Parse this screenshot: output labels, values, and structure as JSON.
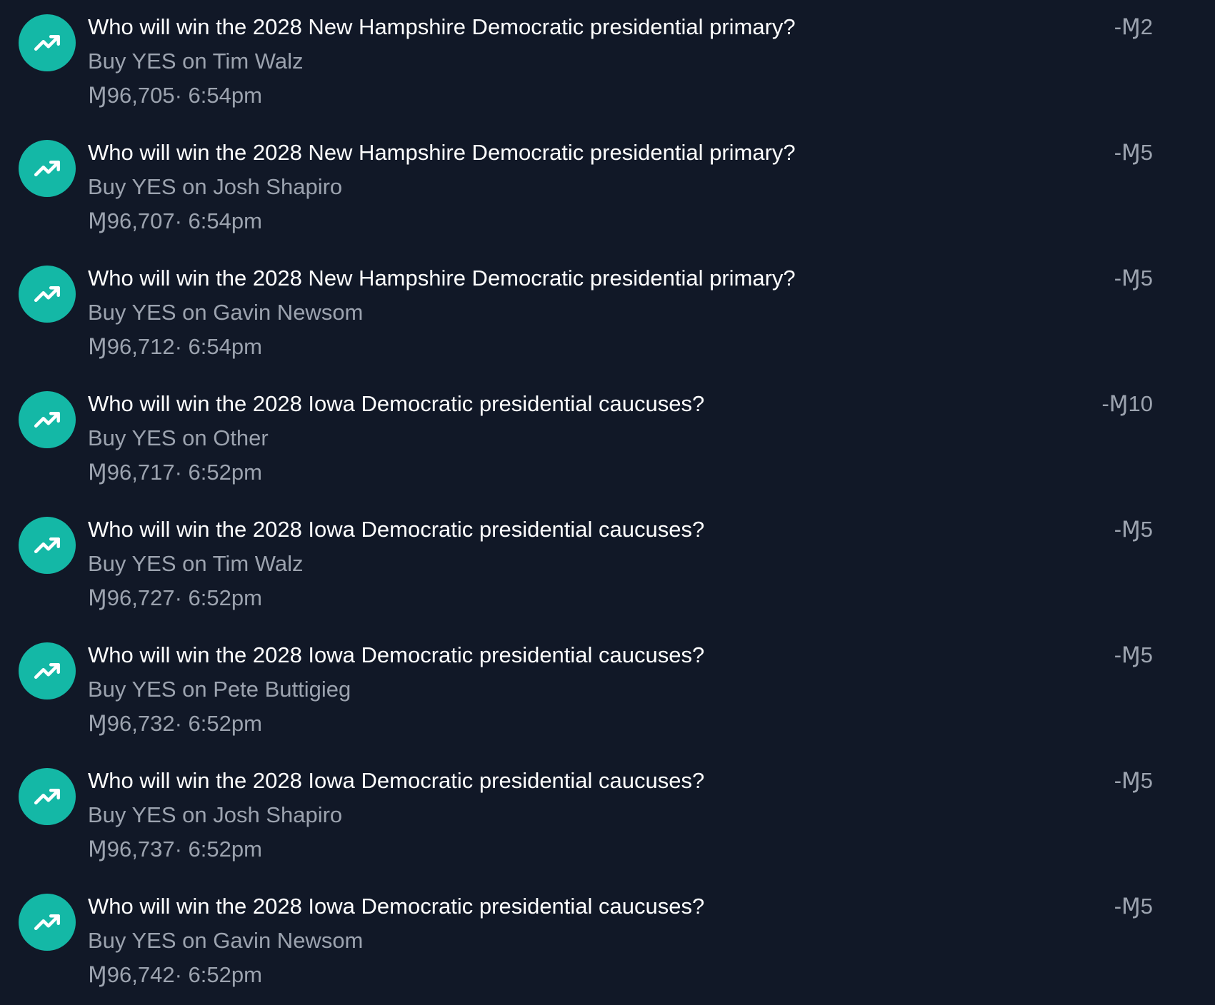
{
  "colors": {
    "background": "#111827",
    "accent": "#14b8a6",
    "primary_text": "#ffffff",
    "secondary_text": "#9ca3af"
  },
  "transactions": [
    {
      "icon": "trending-up-icon",
      "title": "Who will win the 2028 New Hampshire Democratic presidential primary?",
      "action": "Buy YES on Tim Walz",
      "balance": "Ɱ96,705",
      "time": "· 6:54pm",
      "amount": "-Ɱ2"
    },
    {
      "icon": "trending-up-icon",
      "title": "Who will win the 2028 New Hampshire Democratic presidential primary?",
      "action": "Buy YES on Josh Shapiro",
      "balance": "Ɱ96,707",
      "time": "· 6:54pm",
      "amount": "-Ɱ5"
    },
    {
      "icon": "trending-up-icon",
      "title": "Who will win the 2028 New Hampshire Democratic presidential primary?",
      "action": "Buy YES on Gavin Newsom",
      "balance": "Ɱ96,712",
      "time": "· 6:54pm",
      "amount": "-Ɱ5"
    },
    {
      "icon": "trending-up-icon",
      "title": "Who will win the 2028 Iowa Democratic presidential caucuses?",
      "action": "Buy YES on Other",
      "balance": "Ɱ96,717",
      "time": "· 6:52pm",
      "amount": "-Ɱ10"
    },
    {
      "icon": "trending-up-icon",
      "title": "Who will win the 2028 Iowa Democratic presidential caucuses?",
      "action": "Buy YES on Tim Walz",
      "balance": "Ɱ96,727",
      "time": "· 6:52pm",
      "amount": "-Ɱ5"
    },
    {
      "icon": "trending-up-icon",
      "title": "Who will win the 2028 Iowa Democratic presidential caucuses?",
      "action": "Buy YES on Pete Buttigieg",
      "balance": "Ɱ96,732",
      "time": "· 6:52pm",
      "amount": "-Ɱ5"
    },
    {
      "icon": "trending-up-icon",
      "title": "Who will win the 2028 Iowa Democratic presidential caucuses?",
      "action": "Buy YES on Josh Shapiro",
      "balance": "Ɱ96,737",
      "time": "· 6:52pm",
      "amount": "-Ɱ5"
    },
    {
      "icon": "trending-up-icon",
      "title": "Who will win the 2028 Iowa Democratic presidential caucuses?",
      "action": "Buy YES on Gavin Newsom",
      "balance": "Ɱ96,742",
      "time": "· 6:52pm",
      "amount": "-Ɱ5"
    }
  ]
}
